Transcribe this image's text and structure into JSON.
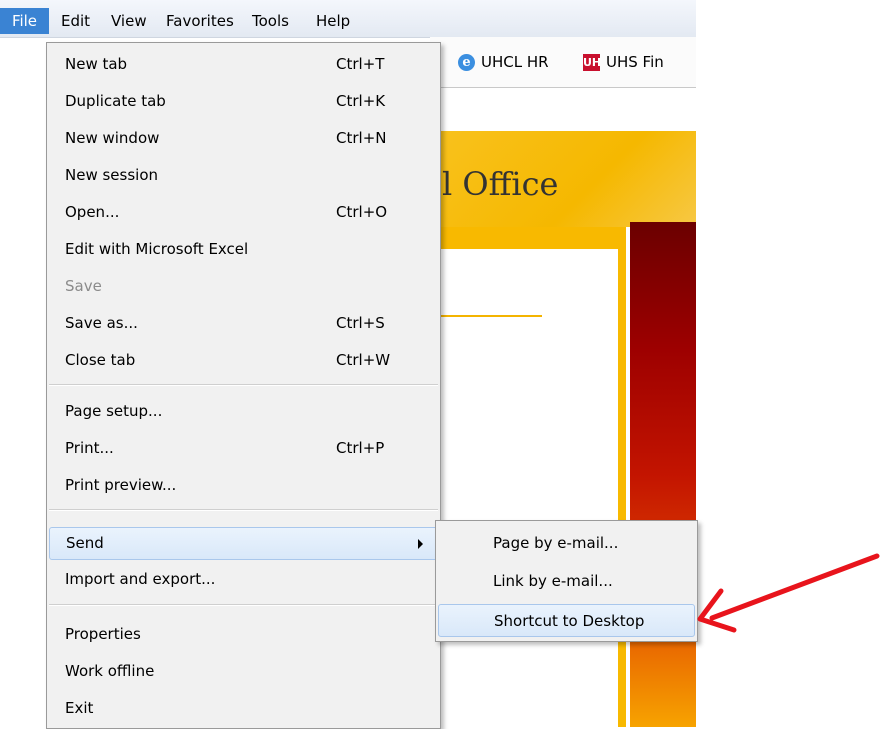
{
  "menubar": {
    "items": [
      "File",
      "Edit",
      "View",
      "Favorites",
      "Tools",
      "Help"
    ]
  },
  "favorites": {
    "items": [
      "UHCL HR",
      "UHS Fin"
    ]
  },
  "page": {
    "hero_title": "l Office"
  },
  "file_menu": {
    "items": [
      {
        "label": "New tab",
        "shortcut": "Ctrl+T"
      },
      {
        "label": "Duplicate tab",
        "shortcut": "Ctrl+K"
      },
      {
        "label": "New window",
        "shortcut": "Ctrl+N"
      },
      {
        "label": "New session",
        "shortcut": ""
      },
      {
        "label": "Open...",
        "shortcut": "Ctrl+O"
      },
      {
        "label": "Edit with Microsoft Excel",
        "shortcut": ""
      },
      {
        "label": "Save",
        "shortcut": ""
      },
      {
        "label": "Save as...",
        "shortcut": "Ctrl+S"
      },
      {
        "label": "Close tab",
        "shortcut": "Ctrl+W"
      },
      {
        "label": "Page setup...",
        "shortcut": ""
      },
      {
        "label": "Print...",
        "shortcut": "Ctrl+P"
      },
      {
        "label": "Print preview...",
        "shortcut": ""
      },
      {
        "label": "Send",
        "shortcut": ""
      },
      {
        "label": "Import and export...",
        "shortcut": ""
      },
      {
        "label": "Properties",
        "shortcut": ""
      },
      {
        "label": "Work offline",
        "shortcut": ""
      },
      {
        "label": "Exit",
        "shortcut": ""
      }
    ]
  },
  "send_submenu": {
    "items": [
      "Page by e-mail...",
      "Link by e-mail...",
      "Shortcut to Desktop"
    ]
  },
  "colors": {
    "menu_selected": "#3a83d3",
    "hover_bg": "#d9e8f9",
    "annotation_arrow": "#e8141c"
  }
}
